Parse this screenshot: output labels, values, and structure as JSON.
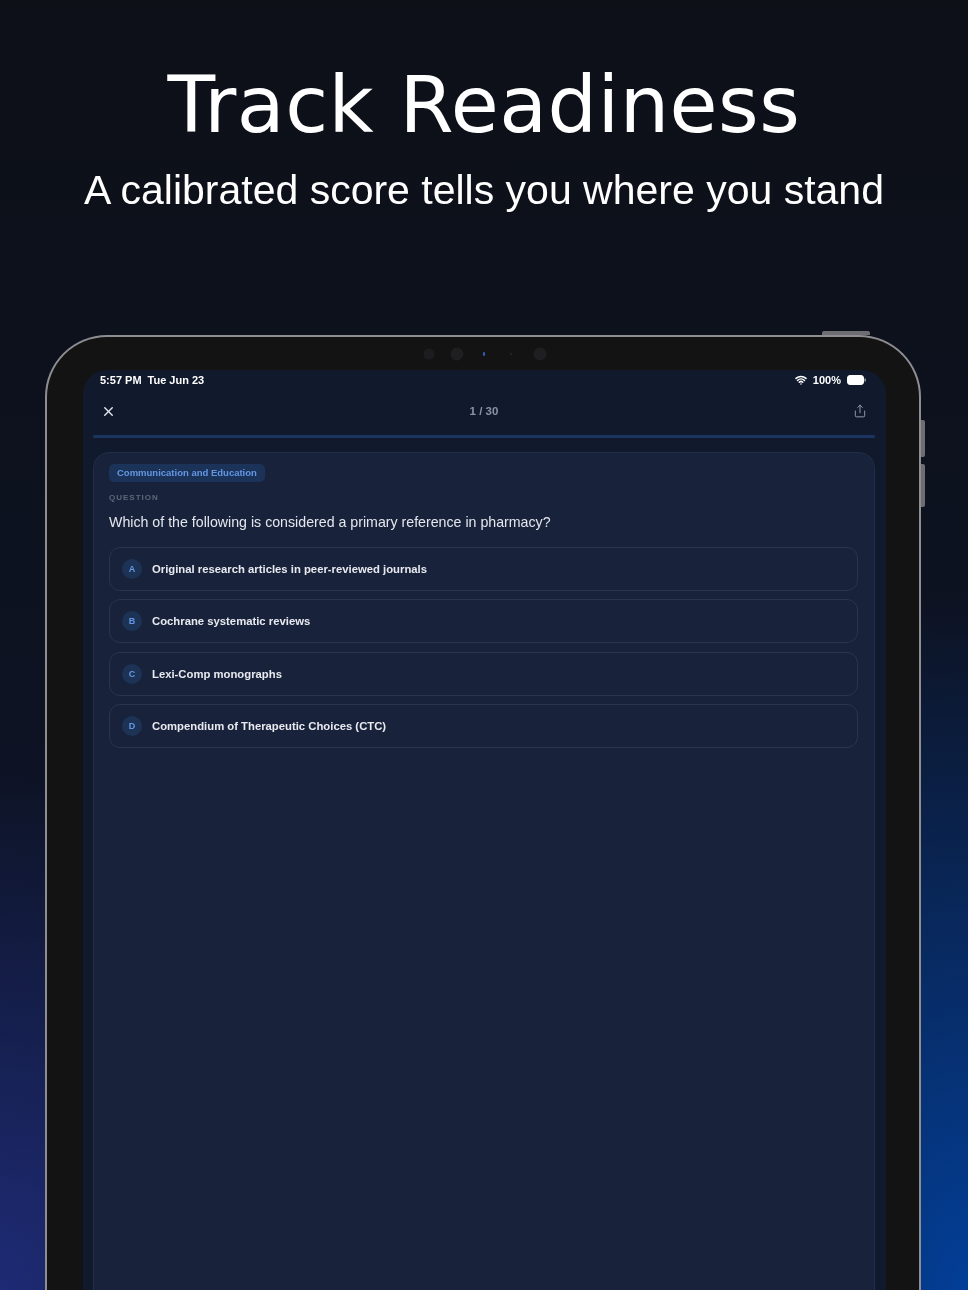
{
  "headline": {
    "title": "Track Readiness",
    "subtitle": "A calibrated score tells you where you stand"
  },
  "status_bar": {
    "time": "5:57 PM",
    "date": "Tue Jun 23",
    "battery": "100%"
  },
  "quiz_header": {
    "counter": "1 / 30"
  },
  "question_card": {
    "category": "Communication and Education",
    "label": "QUESTION",
    "question": "Which of the following is considered a primary reference in pharmacy?",
    "options": [
      {
        "letter": "A",
        "text": "Original research articles in peer-reviewed journals",
        "selected": false
      },
      {
        "letter": "B",
        "text": "Cochrane systematic reviews",
        "selected": false
      },
      {
        "letter": "C",
        "text": "Lexi-Comp monographs",
        "selected": false
      },
      {
        "letter": "D",
        "text": "Compendium of Therapeutic Choices (CTC)",
        "selected": false
      }
    ]
  }
}
